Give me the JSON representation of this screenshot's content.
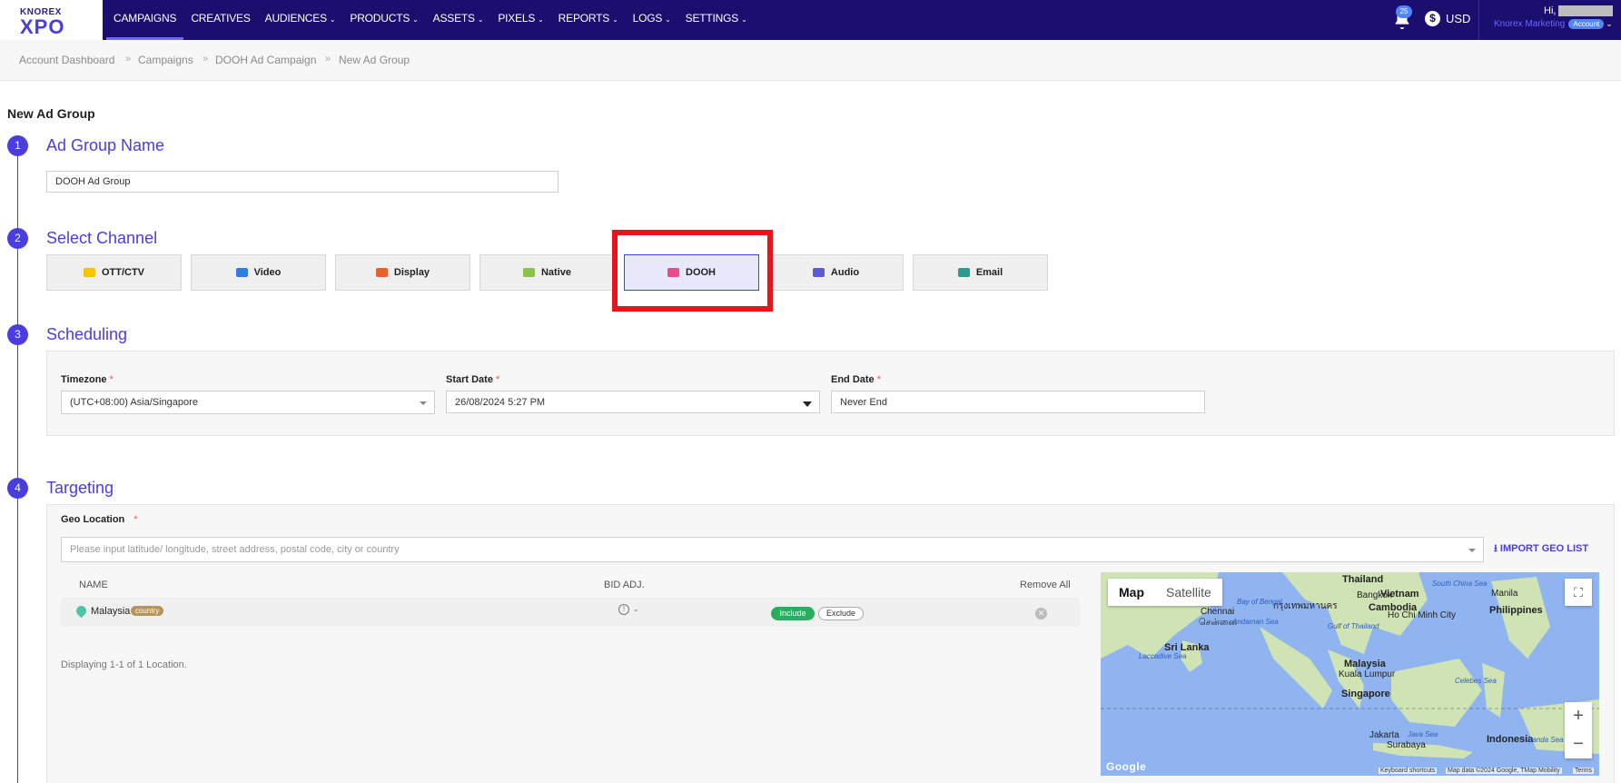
{
  "nav": {
    "logo_top": "KNOREX",
    "logo_main": "XPO",
    "menu": [
      {
        "label": "CAMPAIGNS",
        "active": true,
        "dropdown": false
      },
      {
        "label": "CREATIVES",
        "active": false,
        "dropdown": false
      },
      {
        "label": "AUDIENCES",
        "active": false,
        "dropdown": true
      },
      {
        "label": "PRODUCTS",
        "active": false,
        "dropdown": true
      },
      {
        "label": "ASSETS",
        "active": false,
        "dropdown": true
      },
      {
        "label": "PIXELS",
        "active": false,
        "dropdown": true
      },
      {
        "label": "REPORTS",
        "active": false,
        "dropdown": true
      },
      {
        "label": "LOGS",
        "active": false,
        "dropdown": true
      },
      {
        "label": "SETTINGS",
        "active": false,
        "dropdown": true
      }
    ],
    "notif_count": "25",
    "currency_symbol": "$",
    "currency": "USD",
    "greeting": "Hi,",
    "account_name": "Knorex Marketing",
    "account_pill": "Account"
  },
  "breadcrumb": [
    "Account Dashboard",
    "Campaigns",
    "DOOH Ad Campaign",
    "New Ad Group"
  ],
  "breadcrumb_sep": "»",
  "page_title": "New Ad Group",
  "sections": {
    "s1": {
      "num": "1",
      "title": "Ad Group Name",
      "value": "DOOH Ad Group"
    },
    "s2": {
      "num": "2",
      "title": "Select Channel"
    },
    "s3": {
      "num": "3",
      "title": "Scheduling"
    },
    "s4": {
      "num": "4",
      "title": "Targeting"
    }
  },
  "channels": [
    {
      "label": "OTT/CTV",
      "color": "#f5c400",
      "selected": false
    },
    {
      "label": "Video",
      "color": "#2f7de1",
      "selected": false
    },
    {
      "label": "Display",
      "color": "#e8602c",
      "selected": false
    },
    {
      "label": "Native",
      "color": "#8bc34a",
      "selected": false
    },
    {
      "label": "DOOH",
      "color": "#e94b8a",
      "selected": true
    },
    {
      "label": "Audio",
      "color": "#5b5bd6",
      "selected": false
    },
    {
      "label": "Email",
      "color": "#2a9d8f",
      "selected": false
    }
  ],
  "scheduling": {
    "timezone_label": "Timezone",
    "timezone_value": "(UTC+08:00) Asia/Singapore",
    "start_label": "Start Date",
    "start_value": "26/08/2024 5:27 PM",
    "end_label": "End Date",
    "end_value": "Never End",
    "required_mark": "*"
  },
  "targeting": {
    "geo_label": "Geo Location",
    "geo_placeholder": "Please input latitude/ longitude, street address, postal code, city or country",
    "import_label": "IMPORT GEO LIST",
    "col_name": "NAME",
    "col_bid": "BID ADJ.",
    "col_remove": "Remove All",
    "row_country": "Malaysia",
    "row_tag": "country",
    "include": "Include",
    "exclude": "Exclude",
    "displaying": "Displaying 1-1 of 1 Location."
  },
  "map": {
    "tab_map": "Map",
    "tab_satellite": "Satellite",
    "zoom_in": "+",
    "zoom_out": "−",
    "labels": [
      {
        "t": "Thailand",
        "k": "big"
      },
      {
        "t": "Bangkok",
        "k": ""
      },
      {
        "t": "กรุงเทพมหานคร",
        "k": ""
      },
      {
        "t": "Vietnam",
        "k": "big"
      },
      {
        "t": "South China Sea",
        "k": "sea"
      },
      {
        "t": "Manila",
        "k": ""
      },
      {
        "t": "Philippines",
        "k": "big"
      },
      {
        "t": "Cambodia",
        "k": "big"
      },
      {
        "t": "Ho Chi Minh City",
        "k": ""
      },
      {
        "t": "Chennai",
        "k": ""
      },
      {
        "t": "சென்னை",
        "k": ""
      },
      {
        "t": "Bay of Bengal",
        "k": "sea"
      },
      {
        "t": "Andaman Sea",
        "k": "sea"
      },
      {
        "t": "Gulf of Thailand",
        "k": "sea"
      },
      {
        "t": "Sri Lanka",
        "k": "big"
      },
      {
        "t": "Laccadive Sea",
        "k": "sea"
      },
      {
        "t": "Malaysia",
        "k": "big"
      },
      {
        "t": "Kuala Lumpur",
        "k": ""
      },
      {
        "t": "Singapore",
        "k": "big"
      },
      {
        "t": "Celebes Sea",
        "k": "sea"
      },
      {
        "t": "Indonesia",
        "k": "big"
      },
      {
        "t": "Jakarta",
        "k": ""
      },
      {
        "t": "Java Sea",
        "k": "sea"
      },
      {
        "t": "Surabaya",
        "k": ""
      },
      {
        "t": "Banda Sea",
        "k": "sea"
      }
    ],
    "footer_shortcuts": "Keyboard shortcuts",
    "footer_data": "Map data ©2024 Google, TMap Mobility",
    "footer_terms": "Terms",
    "google": "Google"
  }
}
